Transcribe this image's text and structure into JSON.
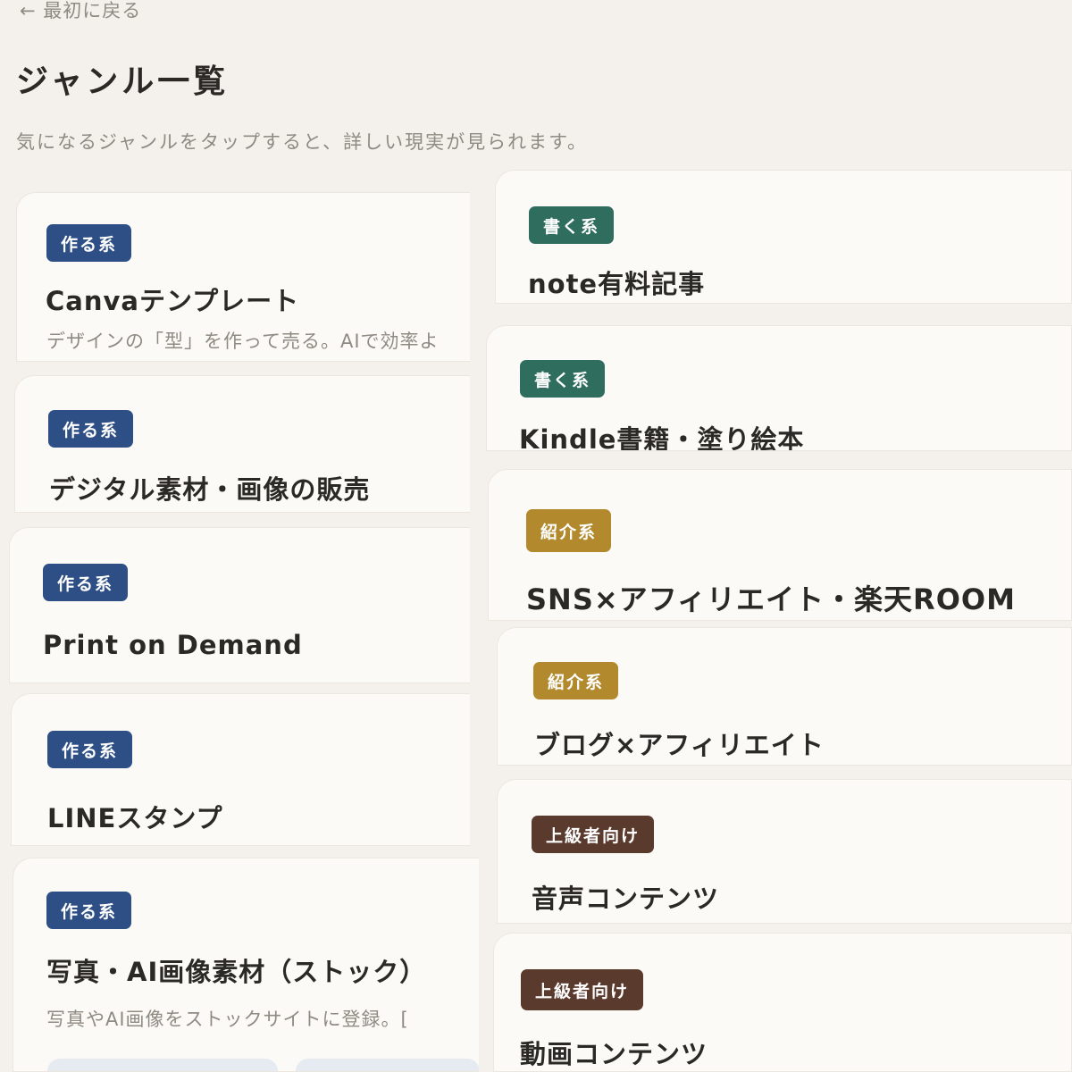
{
  "nav": {
    "back_label": "← 最初に戻る"
  },
  "header": {
    "title": "ジャンル一覧",
    "description": "気になるジャンルをタップすると、詳しい現実が見られます。"
  },
  "left_cards": [
    {
      "badge": "作る系",
      "title": "Canvaテンプレート",
      "description": "デザインの「型」を作って売る。AIで効率よ"
    },
    {
      "badge": "作る系",
      "title": "デジタル素材・画像の販売"
    },
    {
      "badge": "作る系",
      "title": "Print on Demand"
    },
    {
      "badge": "作る系",
      "title": "LINEスタンプ"
    },
    {
      "badge": "作る系",
      "title": "写真・AI画像素材（ストック）",
      "description": "写真やAI画像をストックサイトに登録。["
    }
  ],
  "right_cards": [
    {
      "badge": "書く系",
      "title": "note有料記事"
    },
    {
      "badge": "書く系",
      "title": "Kindle書籍・塗り絵本"
    },
    {
      "badge": "紹介系",
      "title": "SNS×アフィリエイト・楽天ROOM"
    },
    {
      "badge": "紹介系",
      "title": "ブログ×アフィリエイト"
    },
    {
      "badge": "上級者向け",
      "title": "音声コンテンツ"
    },
    {
      "badge": "上級者向け",
      "title": "動画コンテンツ"
    }
  ],
  "colors": {
    "make": "#2e4f85",
    "write": "#2f6d5e",
    "intro": "#b28a2d",
    "advanced": "#5a3a2d",
    "background": "#f4f1ec",
    "card": "#fcfaf7"
  }
}
